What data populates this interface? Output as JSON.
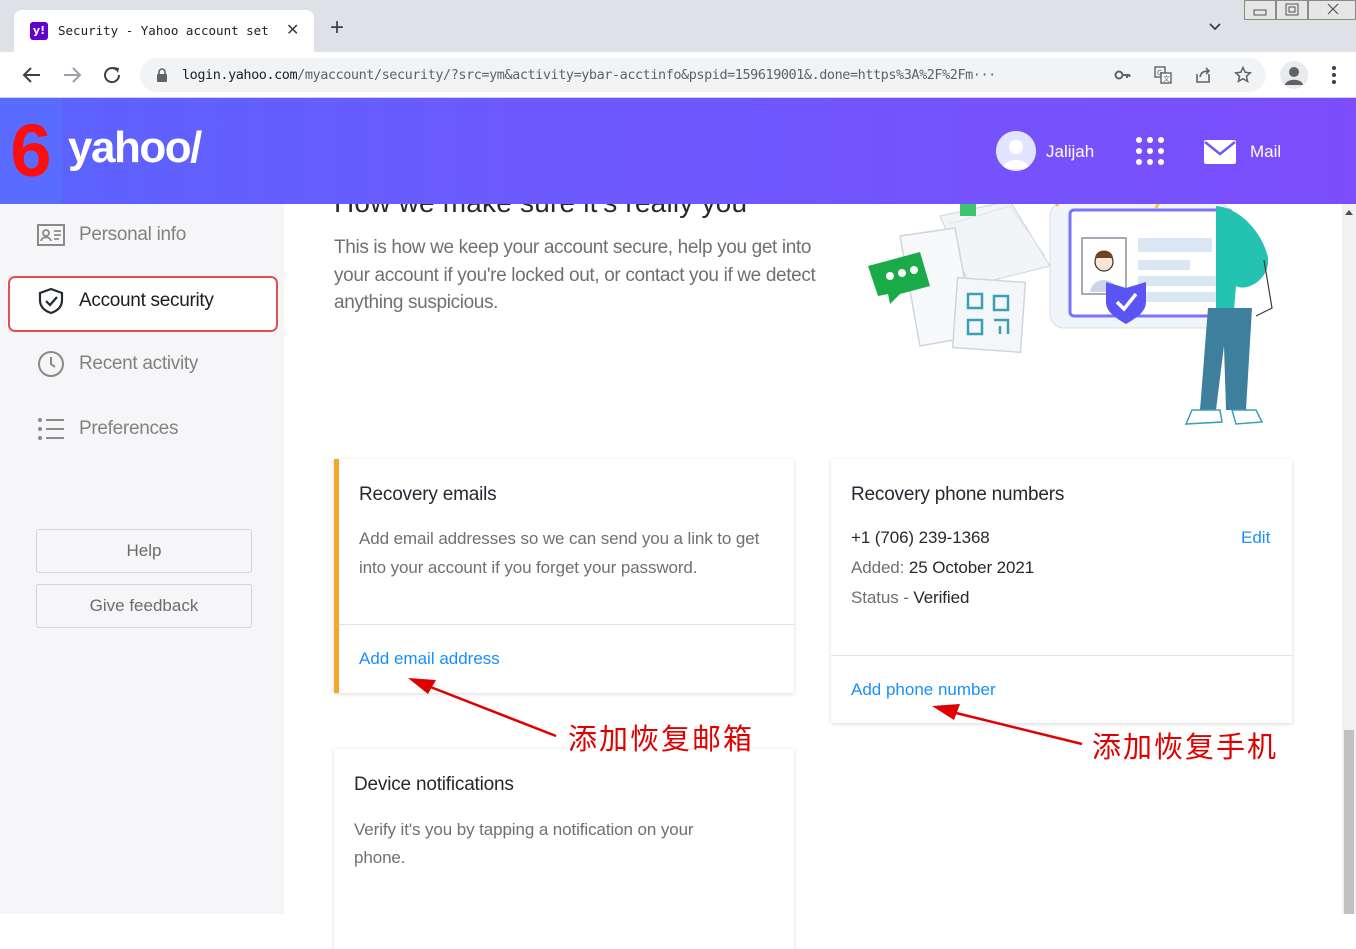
{
  "browser": {
    "tab_title": "Security - Yahoo account set",
    "favicon_text": "y!",
    "url_host": "login.yahoo.com",
    "url_path": "/myaccount/security/?src=ym&activity=ybar-acctinfo&pspid=159619001&.done=https%3A%2F%2Fm···",
    "accent_color": "#6001d2"
  },
  "annotation": {
    "step_number": "6",
    "email_callout": "添加恢复邮箱",
    "phone_callout": "添加恢复手机",
    "color": "#e00000"
  },
  "header": {
    "logo": "yahoo/",
    "user_name": "Jalijah",
    "mail_label": "Mail",
    "brand_color": "#6b5bff"
  },
  "sidebar": {
    "items": [
      {
        "label": "Personal info",
        "icon": "id-card-icon"
      },
      {
        "label": "Account security",
        "icon": "shield-check-icon"
      },
      {
        "label": "Recent activity",
        "icon": "clock-icon"
      },
      {
        "label": "Preferences",
        "icon": "list-icon"
      }
    ],
    "help_label": "Help",
    "feedback_label": "Give feedback"
  },
  "main": {
    "title": "How we make sure it's really you",
    "intro": "This is how we keep your account secure, help you get into your account if you're locked out, or contact you if we detect anything suspicious.",
    "recovery_emails": {
      "title": "Recovery emails",
      "description": "Add email addresses so we can send you a link to get into your account if you forget your password.",
      "add_link": "Add email address"
    },
    "recovery_phones": {
      "title": "Recovery phone numbers",
      "phone": "+1 (706) 239-1368",
      "edit_label": "Edit",
      "added_label": "Added:",
      "added_date": "25 October 2021",
      "status_label": "Status -",
      "status_value": "Verified",
      "add_link": "Add phone number"
    },
    "device_notifications": {
      "title": "Device notifications",
      "description": "Verify it's you by tapping a notification on your phone."
    }
  }
}
